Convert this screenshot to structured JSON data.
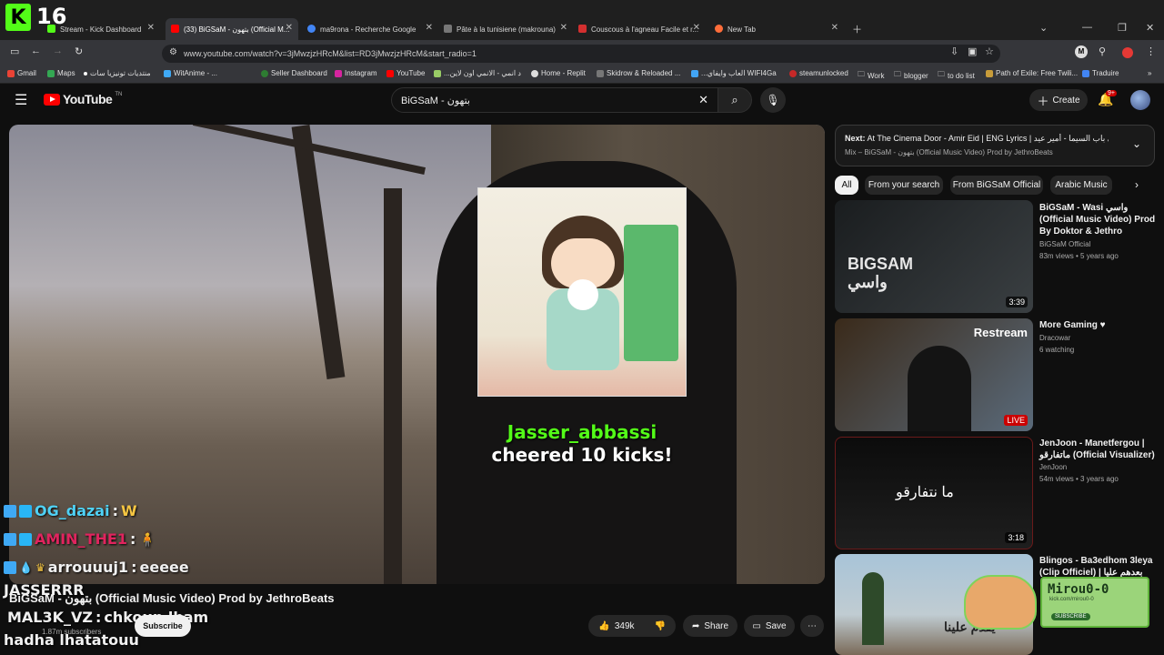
{
  "kick_logo": "16",
  "tabs": [
    {
      "label": "Stream - Kick Dashboard",
      "color": "#53fc18"
    },
    {
      "label": "(33) BiGSaM - بتهون (Official M...",
      "color": "#ff0000"
    },
    {
      "label": "ma9rona - Recherche Google",
      "color": "#4285f4"
    },
    {
      "label": "Pâte à la tunisiene (makrouna)",
      "color": "#777777"
    },
    {
      "label": "Couscous à l'agneau Facile et r...",
      "color": "#d32f2f"
    },
    {
      "label": "New Tab",
      "color": "#ff6d3a"
    }
  ],
  "url": "www.youtube.com/watch?v=3jMwzjzHRcM&list=RD3jMwzjzHRcM&start_radio=1",
  "bookmarks": [
    "Gmail",
    "Maps",
    "منتديات تونيزيا سات",
    "WitAnime - ...",
    "Seller Dashboard",
    "Instagram",
    "YouTube",
    "...د انمي - الانمي اون لاين",
    "Home - Replit",
    "Skidrow & Reloaded ...",
    "...العاب وايفاي WIFI4Ga",
    "steamunlocked",
    "Work",
    "blogger",
    "to do list",
    "Path of Exile: Free Twili...",
    "Traduire"
  ],
  "yt": {
    "logo": "YouTube",
    "logo_sup": "TN",
    "search_value": "BiGSaM - بتهون",
    "create_label": "Create",
    "notif_count": "9+"
  },
  "video": {
    "cheer_user": "Jasser_abbassi",
    "cheer_text": " cheered 10 kicks!",
    "title": "BiGSaM - بتهون (Official Music Video) Prod by JethroBeats",
    "subscribers": "1.87m subscribers",
    "subscribe_label": "Subscribe",
    "likes": "349k",
    "share_label": "Share",
    "save_label": "Save"
  },
  "chat": [
    {
      "user": "OG_dazai",
      "sep": " :",
      "msg": " W",
      "color": "#4fd1f5",
      "msgcolor": "#f5c542"
    },
    {
      "user": "AMIN_THE1",
      "sep": " :",
      "msg": " 🧍",
      "color": "#e0245e",
      "msgcolor": "#ffffff"
    },
    {
      "user": "arrouuuj1",
      "sep": " :",
      "msg": " eeeee",
      "color": "#ffffff",
      "msgcolor": "#ffffff"
    },
    {
      "user": "JASSERRR",
      "sep": "",
      "msg": "",
      "color": "#ffffff",
      "msgcolor": "#ffffff"
    },
    {
      "user": "MAL3K_VZ",
      "sep": " :",
      "msg": " chkoun lham",
      "color": "#ffffff",
      "msgcolor": "#ffffff"
    },
    {
      "user": "hadha lhatatouu",
      "sep": "",
      "msg": "",
      "color": "#ffffff",
      "msgcolor": "#ffffff"
    }
  ],
  "next": {
    "label": "Next:",
    "title": "At The Cinema Door - Amir Eid | ENG Lyrics | على باب السيما - أمير عيد",
    "sub": "Mix – BiGSaM - بتهون (Official Music Video) Prod by JethroBeats"
  },
  "chips": [
    "All",
    "From your search",
    "From BiGSaM Official",
    "Arabic Music"
  ],
  "related": [
    {
      "title": "BiGSaM - Wasi واسي (Official Music Video) Prod By Doktor & Jethro",
      "channel": "BiGSaM Official",
      "meta": "83m views • 5 years ago",
      "duration": "3:39",
      "thumb_text": "BIGSAM واسي"
    },
    {
      "title": "More Gaming ♥",
      "channel": "Dracowar",
      "meta": "6 watching",
      "duration": "LIVE",
      "thumb_text": "Restream"
    },
    {
      "title": "JenJoon - Manetfergou | ماتفارقو (Official Visualizer)",
      "channel": "JenJoon",
      "meta": "54m views • 3 years ago",
      "duration": "3:18",
      "thumb_text": "ما نتفارقو"
    },
    {
      "title": "Blingos - Ba3edhom 3leya (Clip Officiel) | بعدهم عليا",
      "channel": "",
      "meta": "",
      "duration": "",
      "thumb_text": "يقدم علينا"
    }
  ],
  "overlay_card": {
    "name": "Mirou0-0",
    "url": "kick.com/mirou0-0",
    "button": "SUBSCRIBE"
  }
}
